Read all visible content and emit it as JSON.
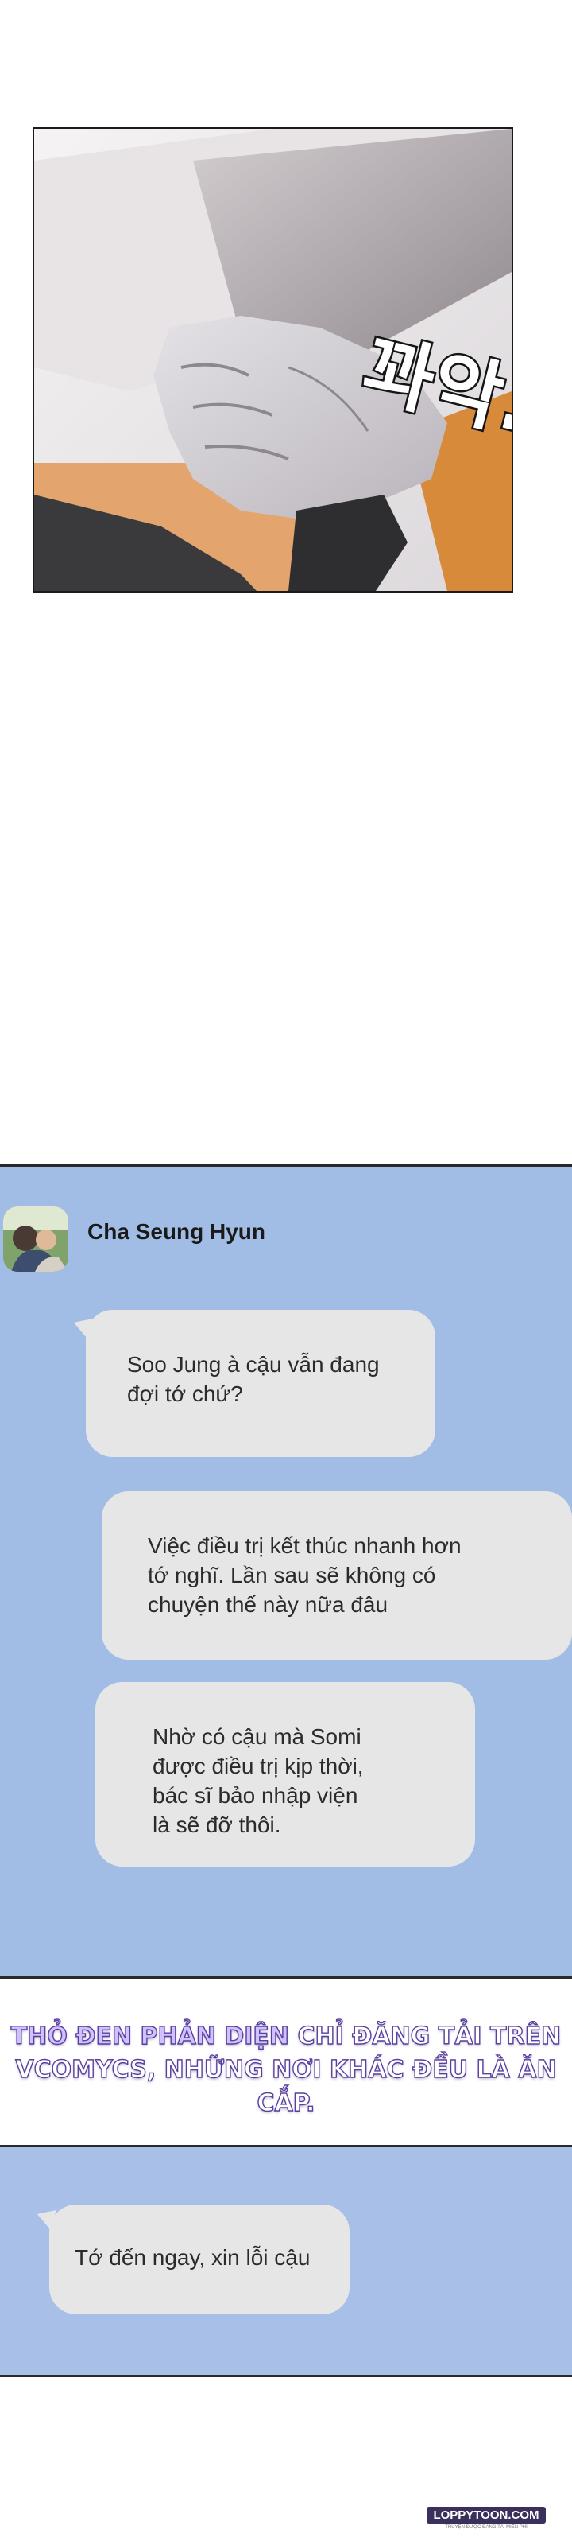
{
  "panel1": {
    "sfx_text": "꽈악..",
    "image_name": "hand-gripping-arm-illustration"
  },
  "chat": {
    "sender": "Cha Seung Hyun",
    "messages": [
      "Soo Jung à cậu vẫn đang\nđợi tớ chứ?",
      "Việc điều trị kết thúc nhanh hơn\ntớ nghĩ. Lần sau sẽ không có\nchuyện thế này nữa đâu",
      "Nhờ có cậu mà Somi\nđược điều trị kịp thời,\nbác sĩ bảo nhập viện\nlà sẽ đỡ thôi."
    ]
  },
  "notice": {
    "highlight": "THỎ ĐEN PHẢN DIỆN",
    "line1_rest": " CHỈ ĐĂNG TẢI TRÊN",
    "line2": "VCOMYCS, NHỮNG NƠI KHÁC ĐỀU LÀ ĂN CẮP."
  },
  "reply": {
    "message": "Tớ đến ngay, xin lỗi cậu"
  },
  "logo": {
    "text": "LOPPYTOON.COM",
    "tagline": "TRUYỆN ĐƯỢC ĐĂNG TẢI MIỄN PHÍ"
  },
  "colors": {
    "chat_bg": "#a2bde5",
    "bubble": "#e6e6e6",
    "notice_outline": "#5a3f9e"
  }
}
